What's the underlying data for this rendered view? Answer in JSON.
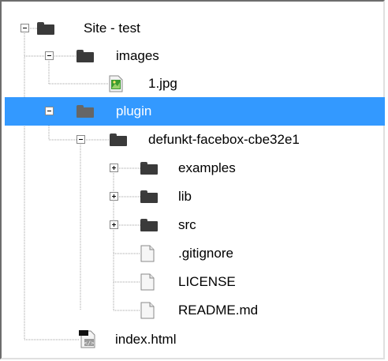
{
  "tree": {
    "items": [
      {
        "label": "Site - test",
        "type": "folder",
        "expander": "minus",
        "selected": false
      },
      {
        "label": "images",
        "type": "folder",
        "expander": "minus",
        "selected": false
      },
      {
        "label": "1.jpg",
        "type": "image-file",
        "expander": "none",
        "selected": false
      },
      {
        "label": "plugin",
        "type": "folder",
        "expander": "minus",
        "selected": true
      },
      {
        "label": "defunkt-facebox-cbe32e1",
        "type": "folder",
        "expander": "minus",
        "selected": false
      },
      {
        "label": "examples",
        "type": "folder",
        "expander": "plus",
        "selected": false
      },
      {
        "label": "lib",
        "type": "folder",
        "expander": "plus",
        "selected": false
      },
      {
        "label": "src",
        "type": "folder",
        "expander": "plus",
        "selected": false
      },
      {
        "label": ".gitignore",
        "type": "file",
        "expander": "none",
        "selected": false
      },
      {
        "label": "LICENSE",
        "type": "file",
        "expander": "none",
        "selected": false
      },
      {
        "label": "README.md",
        "type": "file",
        "expander": "none",
        "selected": false
      },
      {
        "label": "index.html",
        "type": "html-file",
        "expander": "none",
        "selected": false
      }
    ]
  },
  "colors": {
    "selection": "#3399ff",
    "folder": "#3a3a3a",
    "tree_lines": "#a0a0a0",
    "image_icon": "#3c9a2f"
  }
}
